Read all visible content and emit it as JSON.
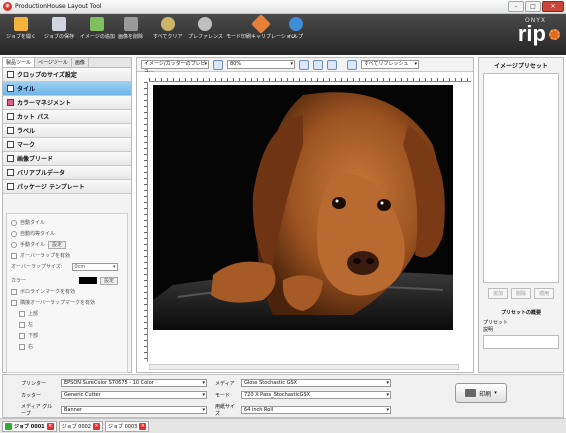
{
  "window": {
    "title": "ProductionHouse Layout Tool",
    "app_icon": "onyx-icon"
  },
  "toolbar": {
    "items": [
      {
        "label": "ジョブを開く",
        "icon": "folder-open-icon",
        "color": "#f2b43a"
      },
      {
        "label": "ジョブの保存",
        "icon": "save-icon",
        "color": "#cfd6df"
      },
      {
        "label": "イメージの追加",
        "icon": "add-image-icon",
        "color": "#7fbf5f"
      },
      {
        "label": "画像を削除",
        "icon": "delete-image-icon",
        "color": "#9a9a9a"
      },
      {
        "label": "すべてクリア",
        "icon": "trash-icon",
        "color": "#cbb46a"
      },
      {
        "label": "プレファレンス",
        "icon": "gear-icon",
        "color": "#bfbfbf"
      },
      {
        "label": "モード印刷キャリブレーション",
        "icon": "calibration-icon",
        "color": "#e8803a"
      },
      {
        "label": "ヘルプ",
        "icon": "help-icon",
        "color": "#3f8fd8"
      }
    ],
    "logo": {
      "brand": "ONYX",
      "product": "rip",
      "accent": "#e06b1c"
    }
  },
  "left": {
    "tabs": [
      "製品ツール",
      "ページツール",
      "画像"
    ],
    "sections": [
      {
        "label": "クロップのサイズ設定",
        "icon": "crop-icon"
      },
      {
        "label": "タイル",
        "icon": "tile-icon",
        "selected": true
      },
      {
        "label": "カラーマネジメント",
        "icon": "color-icon"
      },
      {
        "label": "カット パス",
        "icon": "cutpath-icon"
      },
      {
        "label": "ラベル",
        "icon": "label-icon"
      },
      {
        "label": "マーク",
        "icon": "mark-icon"
      },
      {
        "label": "画像ブリード",
        "icon": "bleed-icon"
      },
      {
        "label": "バリアブルデータ",
        "icon": "variable-data-icon"
      },
      {
        "label": "パッケージ テンプレート",
        "icon": "template-icon"
      }
    ],
    "panel": {
      "auto_tile": "自動タイル",
      "auto_equal": "自動均等タイル",
      "manual": "手動タイル",
      "setup": "設定",
      "overlap_enable": "オーバーラップを有効",
      "overlap_size": "オーバーラップサイズ:",
      "overlap_value": "0cm",
      "color": "カラー",
      "color_setup": "設定",
      "tile_line": "ボロラインマークを有効",
      "overlap_mark": "隣接オーバーラップマークを有効",
      "top": "上部",
      "left": "左",
      "bottom": "下部",
      "right": "右"
    }
  },
  "canvas": {
    "view_mode": "イメージ/カッターのプレビュ...",
    "zoom": "80%",
    "preset": "すべてリフレッシュ"
  },
  "right": {
    "title": "イメージプリセット",
    "btn_add": "追加",
    "btn_delete": "削除",
    "btn_apply": "適用",
    "summary": "プリセットの概要",
    "preset": "プリセット",
    "description": "説明"
  },
  "bottom": {
    "printer_label": "プリンター",
    "printer_value": "EPSON SureColor S70675 - 10 Color",
    "cutter_label": "カッター",
    "cutter_value": "Generic Cutter",
    "media_group_label": "メディア グループ",
    "media_group_value": "Banner",
    "media_label": "メディア",
    "media_value": "Gloss Stochastic GSX",
    "mode_label": "モード",
    "mode_value": "720 X Pass_StochasticGSX",
    "paper_label": "用紙サイズ",
    "paper_value": "64 inch Roll",
    "print_button": "印刷"
  },
  "jobs": [
    {
      "label": "ジョブ 0001",
      "active": true
    },
    {
      "label": "ジョブ 0002"
    },
    {
      "label": "ジョブ 0003"
    }
  ]
}
